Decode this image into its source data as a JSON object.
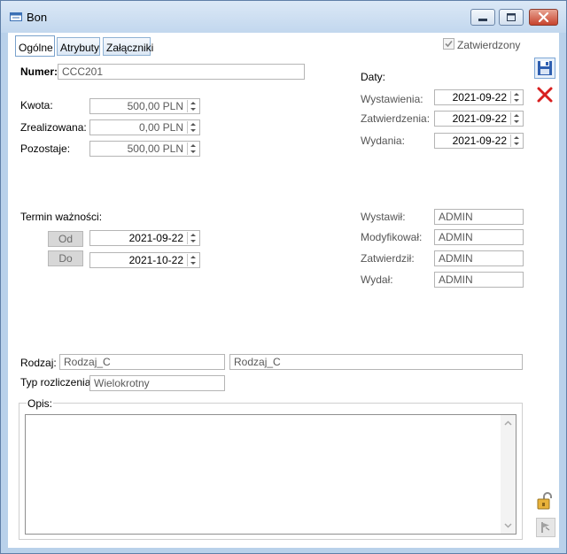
{
  "window": {
    "title": "Bon"
  },
  "tabs": [
    {
      "label": "Ogólne"
    },
    {
      "label": "Atrybuty"
    },
    {
      "label": "Załączniki"
    }
  ],
  "approved": {
    "label": "Zatwierdzony",
    "checked": true
  },
  "form": {
    "numer_label": "Numer:",
    "numer_value": "CCC201",
    "kwota_label": "Kwota:",
    "kwota_value": "500,00 PLN",
    "zrealizowana_label": "Zrealizowana:",
    "zrealizowana_value": "0,00 PLN",
    "pozostaje_label": "Pozostaje:",
    "pozostaje_value": "500,00 PLN",
    "termin_label": "Termin ważności:",
    "od_label": "Od",
    "od_value": "2021-09-22",
    "do_label": "Do",
    "do_value": "2021-10-22",
    "rodzaj_label": "Rodzaj:",
    "rodzaj_code": "Rodzaj_C",
    "rodzaj_name": "Rodzaj_C",
    "typ_label": "Typ rozliczenia:",
    "typ_value": "Wielokrotny",
    "opis_label": "Opis:"
  },
  "daty": {
    "heading": "Daty:",
    "wystawienia_label": "Wystawienia:",
    "wystawienia_value": "2021-09-22",
    "zatwierdzenia_label": "Zatwierdzenia:",
    "zatwierdzenia_value": "2021-09-22",
    "wydania_label": "Wydania:",
    "wydania_value": "2021-09-22"
  },
  "users": {
    "wystawil_label": "Wystawił:",
    "wystawil_value": "ADMIN",
    "modyfikowal_label": "Modyfikował:",
    "modyfikowal_value": "ADMIN",
    "zatwierdzil_label": "Zatwierdził:",
    "zatwierdzil_value": "ADMIN",
    "wydal_label": "Wydał:",
    "wydal_value": "ADMIN"
  },
  "icons": {
    "save": "save-icon",
    "delete": "delete-icon",
    "lock": "lock-icon",
    "flag": "flag-icon"
  },
  "colors": {
    "title_bar": "#c2d7ee",
    "close_button": "#c7432d",
    "delete_icon": "#d81f1f",
    "save_icon": "#2f5fb0"
  }
}
